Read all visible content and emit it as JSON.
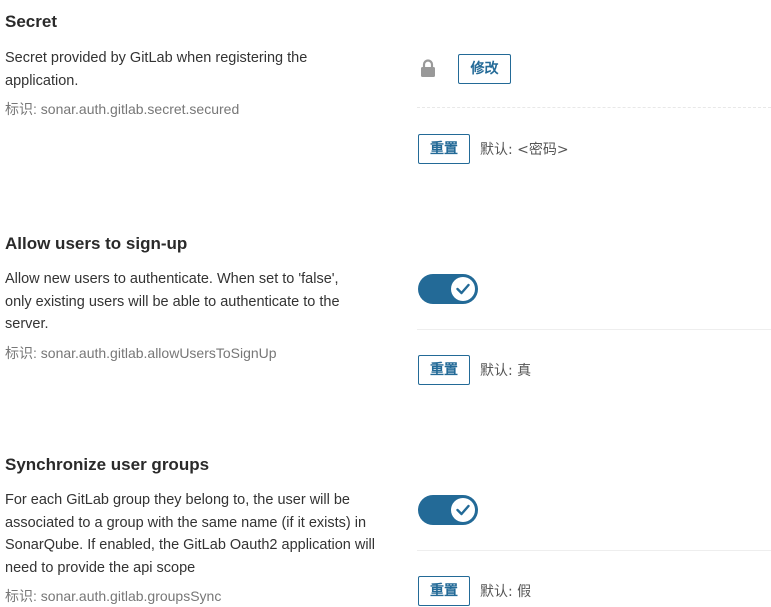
{
  "settings": [
    {
      "title": "Secret",
      "description": "Secret provided by GitLab when registering the application.",
      "key": "标识: sonar.auth.gitlab.secret.secured",
      "control": "password",
      "change_label": "修改",
      "reset_label": "重置",
      "default_label": "默认: <密码>",
      "icon": "lock-icon"
    },
    {
      "title": "Allow users to sign-up",
      "description": "Allow new users to authenticate. When set to 'false', only existing users will be able to authenticate to the server.",
      "key": "标识: sonar.auth.gitlab.allowUsersToSignUp",
      "control": "toggle",
      "toggle_on": true,
      "reset_label": "重置",
      "default_label": "默认: 真"
    },
    {
      "title": "Synchronize user groups",
      "description": "For each GitLab group they belong to, the user will be associated to a group with the same name (if it exists) in SonarQube. If enabled, the GitLab Oauth2 application will need to provide the api scope",
      "key": "标识: sonar.auth.gitlab.groupsSync",
      "control": "toggle",
      "toggle_on": true,
      "reset_label": "重置",
      "default_label": "默认: 假"
    }
  ],
  "colors": {
    "accent": "#236a97",
    "lock_icon": "#999999",
    "key_text": "#777777"
  }
}
